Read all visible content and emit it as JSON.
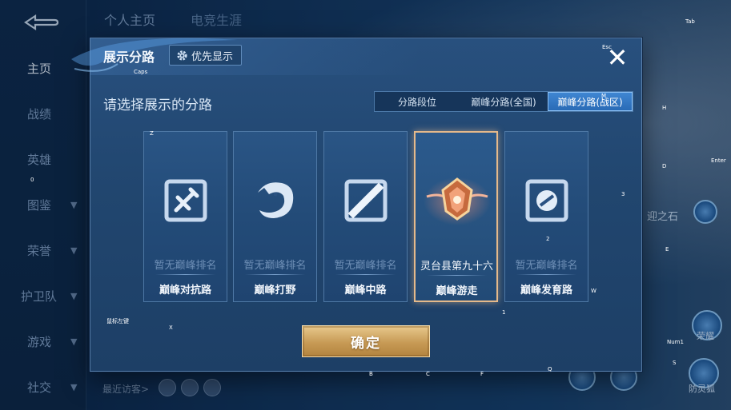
{
  "background": {
    "nav": [
      "主页",
      "战绩",
      "英雄",
      "图鉴",
      "荣誉",
      "护卫队",
      "游戏",
      "社交"
    ],
    "top_tabs": [
      "个人主页",
      "电竞生涯"
    ],
    "recent_visitors_label": "最近访客>",
    "right_side_text_1": "迎之石",
    "right_side_text_2": "荣耀",
    "right_side_text_3": "防灵狐"
  },
  "dialog": {
    "title": "展示分路",
    "priority_button": "优先显示",
    "subtitle": "请选择展示的分路",
    "segments": [
      "分路段位",
      "巅峰分路(全国)",
      "巅峰分路(战区)"
    ],
    "active_segment": 2,
    "cards": [
      {
        "rank": "暂无巅峰排名",
        "lane": "巅峰对抗路",
        "icon": "sword-lane-icon",
        "selected": false
      },
      {
        "rank": "暂无巅峰排名",
        "lane": "巅峰打野",
        "icon": "dragon-jungle-icon",
        "selected": false
      },
      {
        "rank": "暂无巅峰排名",
        "lane": "巅峰中路",
        "icon": "mid-lane-icon",
        "selected": false
      },
      {
        "rank": "灵台县第九十六",
        "lane": "巅峰游走",
        "icon": "roam-medal-icon",
        "selected": true
      },
      {
        "rank": "暂无巅峰排名",
        "lane": "巅峰发育路",
        "icon": "farm-lane-icon",
        "selected": false
      }
    ],
    "confirm_button": "确定"
  },
  "hotkeys": {
    "caps": "Caps",
    "z": "Z",
    "x": "X",
    "b": "B",
    "c": "C",
    "f": "F",
    "q": "Q",
    "one": "1",
    "two": "2",
    "three": "3",
    "w": "W",
    "e": "E",
    "d": "D",
    "h": "H",
    "enter": "Enter",
    "num1": "Num1",
    "s": "S",
    "esc": "Esc",
    "tab": "Tab",
    "mouse": "鼠标左键",
    "m": "M",
    "zero": "0"
  },
  "colors": {
    "accent_blue": "#2a6bb6",
    "gold_button": "#c79a55",
    "selected_border": "#e5b98a"
  }
}
